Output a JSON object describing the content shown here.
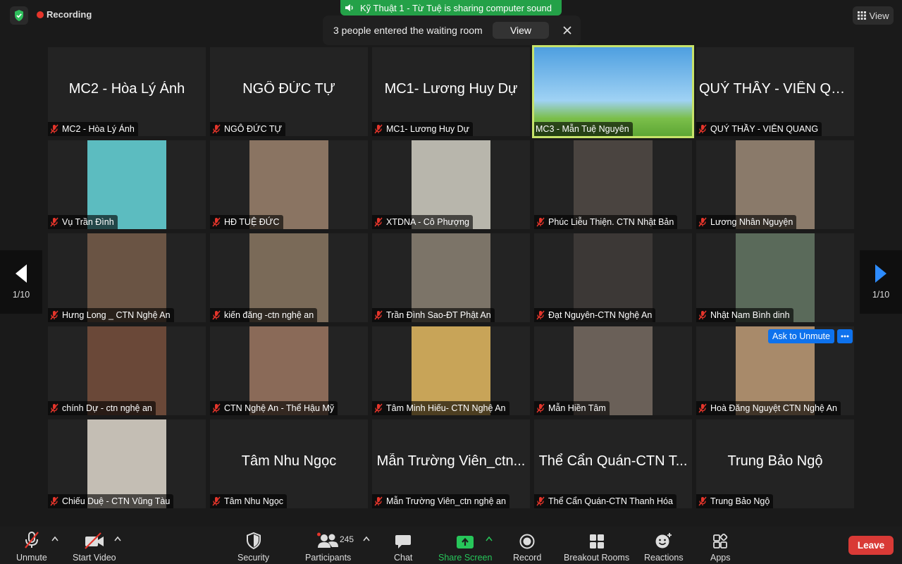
{
  "top": {
    "recording": "Recording",
    "share_banner": "Kỹ Thuật 1  - Từ Tuệ is sharing computer sound",
    "waiting_msg": "3 people entered the waiting room",
    "waiting_view": "View",
    "view_toggle": "View"
  },
  "tiles": [
    {
      "label": "MC2 - Hòa Lý Ánh",
      "big": "MC2 - Hòa Lý Ánh",
      "video": false
    },
    {
      "label": "NGÔ ĐỨC TỰ",
      "big": "NGÔ ĐỨC TỰ",
      "video": false
    },
    {
      "label": "MC1- Lương Huy Dự",
      "big": "MC1- Lương Huy Dự",
      "video": false
    },
    {
      "label": "MC3 - Mẫn Tuệ Nguyên",
      "big": "",
      "video": true,
      "active": true,
      "bg": "#5aa6dc"
    },
    {
      "label": "QUÝ THẦY - VIÊN QUANG",
      "big": "QUÝ THẦY - VIÊN QU...",
      "video": false
    },
    {
      "label": "Vụ Trần Đình",
      "big": "",
      "video": true,
      "bg": "#5cbcc0"
    },
    {
      "label": "HĐ TUỆ ĐỨC",
      "big": "",
      "video": true,
      "bg": "#8a7462"
    },
    {
      "label": "XTDNA - Cô Phượng",
      "big": "",
      "video": true,
      "bg": "#b8b6ac"
    },
    {
      "label": "Phúc Liễu Thiện. CTN Nhật Bản",
      "big": "",
      "video": true,
      "bg": "#4a4440"
    },
    {
      "label": "Lương Nhân Nguyện",
      "big": "",
      "video": true,
      "bg": "#8a7a6a"
    },
    {
      "label": "Hưng Long _ CTN Nghệ An",
      "big": "",
      "video": true,
      "bg": "#6a5444"
    },
    {
      "label": "kiến đăng -ctn nghệ an",
      "big": "",
      "video": true,
      "bg": "#7a6a58"
    },
    {
      "label": "Trần Đình Sao-ĐT Phật  An",
      "big": "",
      "video": true,
      "bg": "#7c7468"
    },
    {
      "label": "Đạt Nguyên-CTN Nghệ An",
      "big": "",
      "video": true,
      "bg": "#3c3836"
    },
    {
      "label": "Nhật Nam Bình dinh",
      "big": "",
      "video": true,
      "bg": "#5a6a5a"
    },
    {
      "label": "chính Dự - ctn nghệ an",
      "big": "",
      "video": true,
      "bg": "#6a4838"
    },
    {
      "label": "CTN Nghệ An -    Thể Hậu Mỹ",
      "big": "",
      "video": true,
      "bg": "#8a6a58"
    },
    {
      "label": "Tâm Minh Hiếu- CTN Nghệ An",
      "big": "",
      "video": true,
      "bg": "#c8a458"
    },
    {
      "label": "Mẫn Hiền Tâm",
      "big": "",
      "video": true,
      "bg": "#6a6058"
    },
    {
      "label": "Hoà Đăng Nguyệt CTN Nghệ An",
      "big": "",
      "video": true,
      "bg": "#a88a6a",
      "hover": true
    },
    {
      "label": "Chiếu Duệ - CTN Vũng Tàu",
      "big": "",
      "video": true,
      "bg": "#c4beb4"
    },
    {
      "label": "Tâm Nhu Ngọc",
      "big": "Tâm Nhu Ngọc",
      "video": false
    },
    {
      "label": "Mẫn Trường Viên_ctn nghệ an",
      "big": "Mẫn Trường Viên_ctn...",
      "video": false
    },
    {
      "label": "Thể Cẩn Quán-CTN Thanh Hóa",
      "big": "Thể Cẩn Quán-CTN T...",
      "video": false
    },
    {
      "label": "Trung Bảo Ngộ",
      "big": "Trung Bảo Ngộ",
      "video": false
    }
  ],
  "hover_actions": {
    "ask_unmute": "Ask to Unmute"
  },
  "pager": {
    "left": "1/10",
    "right": "1/10"
  },
  "toolbar": {
    "unmute": "Unmute",
    "start_video": "Start Video",
    "security": "Security",
    "participants": "Participants",
    "participant_count": "245",
    "chat": "Chat",
    "share_screen": "Share Screen",
    "record": "Record",
    "breakout": "Breakout Rooms",
    "reactions": "Reactions",
    "apps": "Apps",
    "leave": "Leave"
  },
  "colors": {
    "accent_green": "#24a148",
    "leave_red": "#d93a36",
    "active_border": "#c7e36a",
    "blue": "#0e72ed"
  }
}
